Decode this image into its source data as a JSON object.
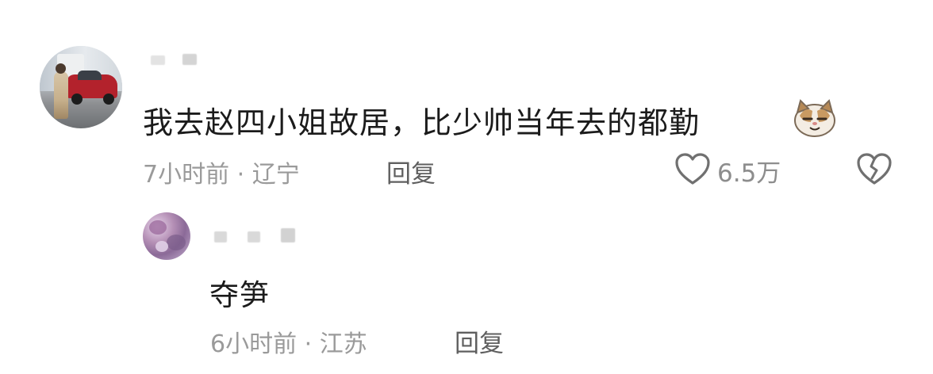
{
  "comment": {
    "text": "我去赵四小姐故居，比少帅当年去的都勤",
    "emoji": "cat-face-emoji",
    "time_location": "7小时前 · 辽宁",
    "reply_label": "回复",
    "like_count": "6.5万",
    "icons": {
      "like": "heart-outline-icon",
      "dislike": "broken-heart-icon"
    }
  },
  "reply": {
    "text": "夺笋",
    "time_location": "6小时前 · 江苏",
    "reply_label": "回复"
  }
}
